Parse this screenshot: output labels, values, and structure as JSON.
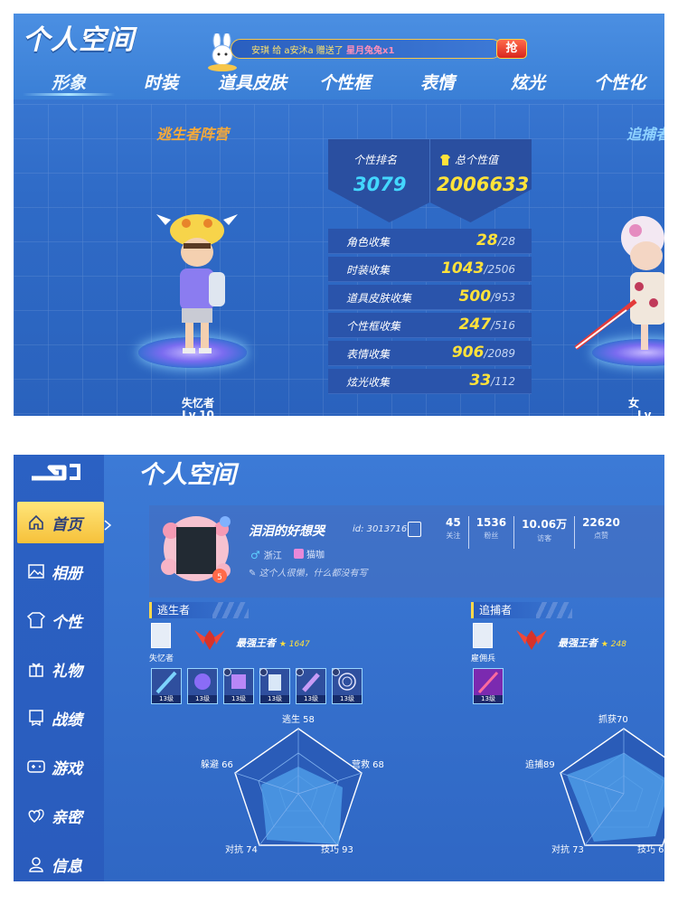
{
  "top": {
    "title": "个人空间",
    "banner": {
      "prefix": "安琪",
      "mid": "给 a安沐a 赠送了",
      "item": "星月兔兔x1",
      "button": "抢"
    },
    "tabs": [
      "形象",
      "时装",
      "道具皮肤",
      "个性框",
      "表情",
      "炫光",
      "个性化"
    ],
    "left_camp": "逃生者阵营",
    "right_camp": "追捕者",
    "left_char": {
      "name": "失忆者",
      "level": "Lv.10"
    },
    "right_char": {
      "name": "女",
      "level": "Lv."
    },
    "rank": {
      "label": "个性排名",
      "value": "3079",
      "total_label": "总个性值",
      "total_value": "2006633"
    },
    "collections": [
      {
        "label": "角色收集",
        "have": "28",
        "total": "/28"
      },
      {
        "label": "时装收集",
        "have": "1043",
        "total": "/2506"
      },
      {
        "label": "道具皮肤收集",
        "have": "500",
        "total": "/953"
      },
      {
        "label": "个性框收集",
        "have": "247",
        "total": "/516"
      },
      {
        "label": "表情收集",
        "have": "906",
        "total": "/2089"
      },
      {
        "label": "炫光收集",
        "have": "33",
        "total": "/112"
      }
    ]
  },
  "bottom": {
    "title": "个人空间",
    "sidebar": [
      "首页",
      "相册",
      "个性",
      "礼物",
      "战绩",
      "游戏",
      "亲密",
      "信息"
    ],
    "profile": {
      "name": "泪泪的好想哭",
      "id": "id: 3013716",
      "location": "浙江",
      "pet": "猫咖",
      "signature": "这个人很懒，什么都没有写",
      "avatar_badge": "5"
    },
    "stats": [
      {
        "value": "45",
        "label": "关注"
      },
      {
        "value": "1536",
        "label": "粉丝"
      },
      {
        "value": "10.06万",
        "label": "访客"
      },
      {
        "value": "22620",
        "label": "点赞"
      }
    ],
    "survivor": {
      "header": "逃生者",
      "char": "失忆者",
      "rank": "最强王者",
      "points": "1647",
      "skin_level": "13级",
      "radar": {
        "top": "逃生 58",
        "right": "营救 68",
        "bottom_right": "技巧 93",
        "bottom_left": "对抗 74",
        "left": "躲避 66"
      }
    },
    "hunter": {
      "header": "追捕者",
      "char": "雇佣兵",
      "rank": "最强王者",
      "points": "248",
      "skin_level": "13级",
      "radar": {
        "top": "抓获70",
        "left": "追捕89",
        "bottom_left": "对抗 73",
        "bottom_right": "技巧 6"
      }
    },
    "colors": {
      "gold": "#ffe23a",
      "cyan": "#43d7ff",
      "panel": "#2f67c4"
    }
  }
}
